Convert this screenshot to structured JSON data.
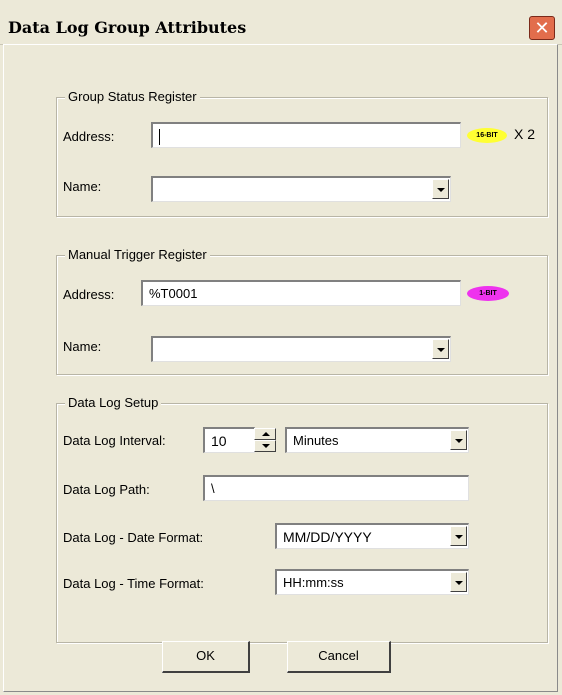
{
  "window": {
    "title": "Data Log Group Attributes",
    "close_glyph": "✕"
  },
  "group_status": {
    "legend": "Group Status Register",
    "address_label": "Address:",
    "address_value": "",
    "badge": "16-BIT",
    "badge_color": "#ffff33",
    "multiplier": "X 2",
    "name_label": "Name:",
    "name_value": ""
  },
  "manual_trigger": {
    "legend": "Manual Trigger Register",
    "address_label": "Address:",
    "address_value": "%T0001",
    "badge": "1-BIT",
    "badge_color": "#ee33ee",
    "name_label": "Name:",
    "name_value": ""
  },
  "data_log_setup": {
    "legend": "Data Log Setup",
    "interval_label": "Data Log Interval:",
    "interval_value": "10",
    "interval_unit": "Minutes",
    "path_label": "Data Log Path:",
    "path_value": "\\",
    "date_format_label": "Data Log  -  Date Format:",
    "date_format_value": "MM/DD/YYYY",
    "time_format_label": "Data Log  -  Time Format:",
    "time_format_value": "HH:mm:ss"
  },
  "buttons": {
    "ok": "OK",
    "cancel": "Cancel"
  }
}
